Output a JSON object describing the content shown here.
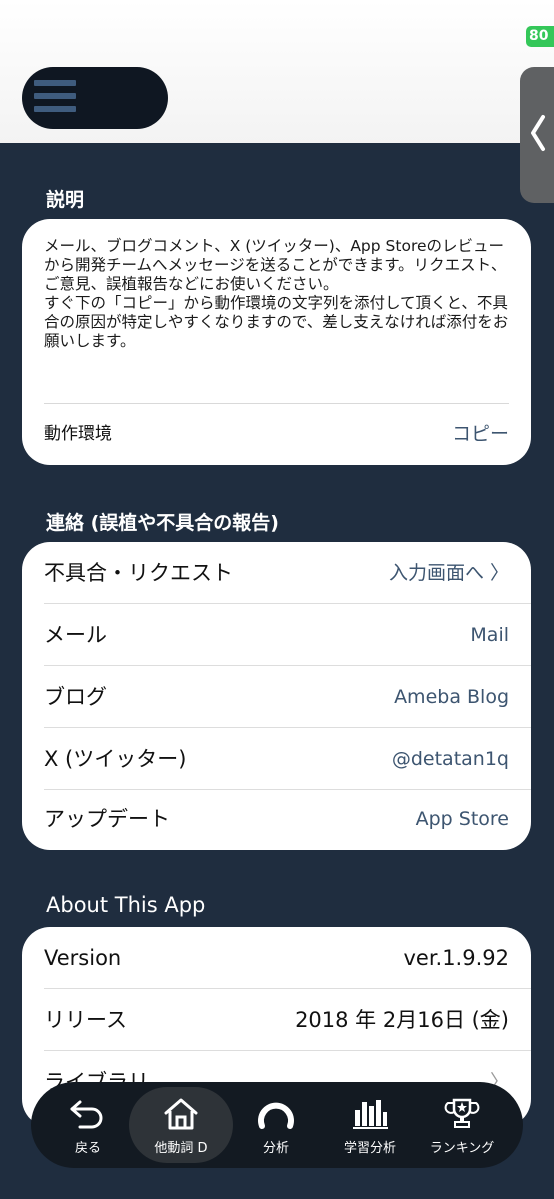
{
  "status": {
    "battery": "80"
  },
  "description_section": {
    "title": "説明",
    "paragraph1": "メール、ブログコメント、X (ツイッター)、App Storeのレビューから開発チームへメッセージを送ることができます。リクエスト、ご意見、誤植報告などにお使いください。",
    "paragraph2": "すぐ下の「コピー」から動作環境の文字列を添付して頂くと、不具合の原因が特定しやすくなりますので、差し支えなければ添付をお願いします。",
    "env_label": "動作環境",
    "copy_label": "コピー"
  },
  "contact_section": {
    "title": "連絡 (誤植や不具合の報告)",
    "rows": [
      {
        "label": "不具合・リクエスト",
        "value": "入力画面へ 〉"
      },
      {
        "label": "メール",
        "value": "Mail"
      },
      {
        "label": "ブログ",
        "value": "Ameba Blog"
      },
      {
        "label": "X (ツイッター)",
        "value": "@detatan1q"
      },
      {
        "label": "アップデート",
        "value": "App Store"
      }
    ]
  },
  "about_section": {
    "title": "About This App",
    "rows": [
      {
        "label": "Version",
        "value": "ver.1.9.92"
      },
      {
        "label": "リリース",
        "value": "2018 年 2月16日 (金)"
      },
      {
        "label": "ライブラリ",
        "value": "〉"
      }
    ]
  },
  "tabbar": {
    "items": [
      {
        "label": "戻る",
        "icon": "back-arrow-icon"
      },
      {
        "label": "他動詞 D",
        "icon": "home-icon"
      },
      {
        "label": "分析",
        "icon": "gauge-icon"
      },
      {
        "label": "学習分析",
        "icon": "bar-chart-icon"
      },
      {
        "label": "ランキング",
        "icon": "trophy-icon"
      }
    ],
    "active_index": 1
  },
  "colors": {
    "background": "#1f2d3f",
    "accent_text": "#3d5570",
    "battery": "#34c759"
  }
}
